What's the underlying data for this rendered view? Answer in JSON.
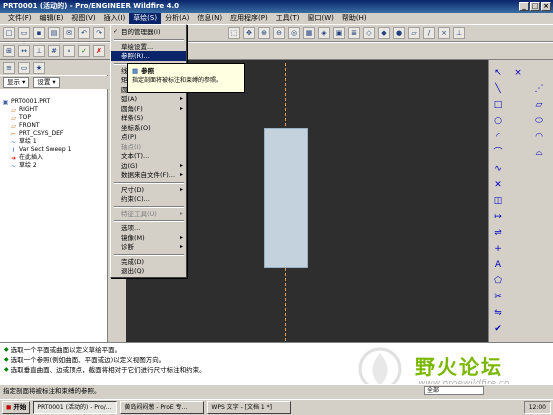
{
  "window": {
    "title": "PRT0001 (活动的) - Pro/ENGINEER Wildfire 4.0",
    "min": "_",
    "max": "□",
    "close": "×"
  },
  "menubar": [
    "文件(F)",
    "编辑(E)",
    "视图(V)",
    "插入(I)",
    "草绘(S)",
    "分析(A)",
    "信息(N)",
    "应用程序(P)",
    "工具(T)",
    "窗口(W)",
    "帮助(H)"
  ],
  "left_panel": {
    "tab_icons": [
      "tree-icon",
      "folder-icon",
      "star-icon"
    ],
    "show_label": "显示 ▾",
    "settings_label": "设置 ▾",
    "tree": [
      {
        "label": "PRT0001.PRT",
        "icon": "part-icon",
        "indent": 0
      },
      {
        "label": "RIGHT",
        "icon": "datum-plane-icon",
        "indent": 1
      },
      {
        "label": "TOP",
        "icon": "datum-plane-icon",
        "indent": 1
      },
      {
        "label": "FRONT",
        "icon": "datum-plane-icon",
        "indent": 1
      },
      {
        "label": "PRT_CSYS_DEF",
        "icon": "csys-icon",
        "indent": 1
      },
      {
        "label": "草绘 1",
        "icon": "sketch-icon",
        "indent": 1
      },
      {
        "label": "Var Sect Sweep 1",
        "icon": "sweep-icon",
        "indent": 1
      },
      {
        "label": "在此插入",
        "icon": "insert-here-icon",
        "indent": 1
      },
      {
        "label": "草绘 2",
        "icon": "sketch-icon",
        "indent": 1
      }
    ]
  },
  "sketch_menu": {
    "items": [
      {
        "label": "目的管理器(I)",
        "check": true
      },
      {
        "sep": true
      },
      {
        "label": "草绘设置..."
      },
      {
        "label": "参照(R)...",
        "highlight": true
      },
      {
        "sep": true
      },
      {
        "label": "线(L)",
        "arrow": true
      },
      {
        "label": "矩形(E)",
        "arrow": true
      },
      {
        "label": "圆(C)",
        "arrow": true
      },
      {
        "label": "弧(A)",
        "arrow": true
      },
      {
        "label": "圆角(F)",
        "arrow": true
      },
      {
        "label": "样条(S)"
      },
      {
        "label": "坐标系(O)"
      },
      {
        "label": "点(P)"
      },
      {
        "label": "轴点(I)",
        "disabled": true
      },
      {
        "label": "文本(T)..."
      },
      {
        "label": "边(G)",
        "arrow": true
      },
      {
        "label": "数据来自文件(F)...",
        "arrow": true
      },
      {
        "sep": true
      },
      {
        "label": "尺寸(D)",
        "arrow": true
      },
      {
        "label": "约束(C)..."
      },
      {
        "sep": true
      },
      {
        "label": "特征工具(U)",
        "arrow": true,
        "disabled": true
      },
      {
        "sep": true
      },
      {
        "label": "选项..."
      },
      {
        "label": "镜像(M)",
        "arrow": true
      },
      {
        "label": "诊断",
        "arrow": true
      },
      {
        "sep": true
      },
      {
        "label": "完成(D)"
      },
      {
        "label": "退出(Q)"
      }
    ]
  },
  "tooltip": {
    "title": "参照",
    "desc": "指定剖面将被标注和束缚的参照。"
  },
  "messages": [
    "选取一个平面或曲面以定义草绘平面。",
    "选取一个参照(例如曲面、平面或边)以定义视图方向。",
    "选取垂直曲面、边或顶点，截面将相对于它们进行尺寸标注和约束。"
  ],
  "status_text": "指定剖面将被标注和束缚的参照。",
  "filter_value": "全部",
  "taskbar": {
    "start": "开始",
    "tasks": [
      "PRT0001 (活动的) - Pro/...",
      "黄岛闷闷葱 - ProE 专...",
      "WPS 文字 - [文档 1 *]"
    ],
    "clock": "12:00"
  },
  "watermark": {
    "text": "野火论坛",
    "url": "www.proewildfire.cn"
  },
  "colors": {
    "canvas": "#2e2e2e",
    "centerline": "#ff9a40",
    "section": "#c4d2de",
    "highlight": "#0a246a"
  }
}
